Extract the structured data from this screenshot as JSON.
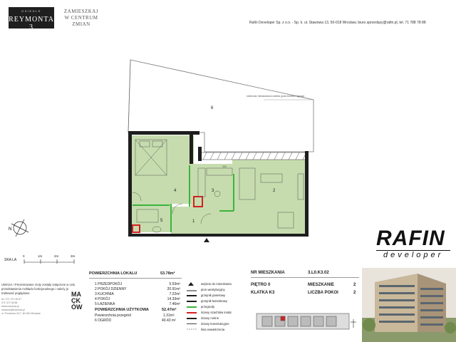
{
  "header": {
    "logo_small": "OSIEDLE",
    "logo_main": "REYMONTA 3",
    "slogan_lines": [
      "ZAMIESZKAJ",
      "W CENTRUM",
      "ZMIAN"
    ],
    "company": "Rafin Developer Sp. z o.o. - Sp. k. ul. Stawowa 13, 50-018 Wrocław, biuro.sprzedazy@rafin.pl, tel. 71 788 78 88"
  },
  "plan": {
    "room_labels": [
      "6",
      "4",
      "3",
      "2",
      "5",
      "1"
    ],
    "terrace_note": "roślinność mieszkańców osiedla (poza terenem ogrodu)",
    "counter_label": "354"
  },
  "scale": {
    "label": "SKA LA",
    "ticks": [
      "0",
      "1m",
      "2m",
      "3m"
    ]
  },
  "note": "UWAGA ! Prezentowane rzuty zostały załączone w celu przedstawienia rozkładu funkcjonalnego i należy je traktować poglądowo.",
  "side_contact": [
    "tel. 071 372 36 87",
    "071 372 36 88",
    "www.mackow.pl",
    "mackow@mackow.pl",
    "ul. Pocztowa 41/7, 50-000 Wrocław"
  ],
  "mackow": [
    "MA",
    "CK",
    "ÓW"
  ],
  "areas": {
    "total_label": "POWIERZCHNIA LOKALU",
    "total_value": "53.78m²",
    "rooms": [
      {
        "name": "1 PRZEDPOKÓJ",
        "value": "5.53m²"
      },
      {
        "name": "2 POKÓJ DZIENNY",
        "value": "20.91m²"
      },
      {
        "name": "3 KUCHNIA",
        "value": "7.22m²"
      },
      {
        "name": "4 POKÓJ",
        "value": "14.33m²"
      },
      {
        "name": "5 ŁAZIENKA",
        "value": "7.46m²"
      }
    ],
    "usable_label": "POWIERZCHNIA UŻYTKOWA",
    "usable_value": "52.47m²",
    "partition_label": "Powierzchnia przegród",
    "partition_value": "1.31m²",
    "garden_label": "6 OGRÓD",
    "garden_value": "40.43 m²"
  },
  "legend": [
    "wejście do mieszkania",
    "pion wentylacyjny",
    "grzejnik panelowy",
    "grzejnik łazienkowy",
    "przegrody",
    "ściany szachtów instal.",
    "ściany nośne",
    "ściany konstrukcyjne",
    "linia nawietrzenia"
  ],
  "info": {
    "nr_label": "NR MIESZKANIA",
    "nr_value": "3.L0.K3.02",
    "floor_label": "PIĘTRO 0",
    "flat_label": "MIESZKANIE",
    "flat_value": "2",
    "stair_label": "KLATKA K3",
    "rooms_label": "LICZBA POKOI",
    "rooms_value": "2"
  },
  "brand": {
    "name": "RAFIN",
    "sub": "developer"
  },
  "colors": {
    "room_green": "#c6dcae",
    "wall": "#1e1e1e",
    "partition_green": "#3cb43c",
    "shaft_red": "#d42020"
  }
}
